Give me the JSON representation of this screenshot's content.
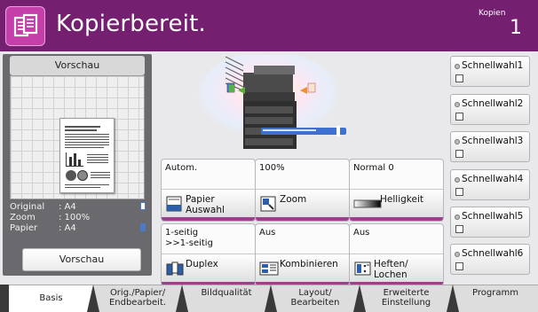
{
  "header": {
    "title": "Kopierbereit.",
    "copies_label": "Kopien",
    "copies_count": "1",
    "icon": "copy-document-icon",
    "colors": {
      "bar": "#741f6f",
      "icon_bg": "#c53fab",
      "accent": "#9b3f91"
    }
  },
  "preview": {
    "title": "Vorschau",
    "info": [
      {
        "label": "Original",
        "value": ": A4",
        "icon": "portrait-page-icon"
      },
      {
        "label": "Zoom",
        "value": ": 100%"
      },
      {
        "label": "Papier",
        "value": ": A4",
        "icon": "paper-tray-icon"
      }
    ],
    "button_label": "Vorschau"
  },
  "functions": {
    "paper": {
      "value": "Autom.",
      "label": "Papier Auswahl",
      "icon": "paper-tray-icon"
    },
    "zoom": {
      "value": "100%",
      "label": "Zoom",
      "icon": "zoom-icon"
    },
    "density": {
      "value": "Normal 0",
      "label": "Helligkeit",
      "icon": "density-icon"
    },
    "duplex": {
      "value_line1": "1-seitig",
      "value_line2": ">>1-seitig",
      "label": "Duplex",
      "icon": "duplex-icon"
    },
    "combine": {
      "value": "Aus",
      "label": "Kombinieren",
      "icon": "combine-icon"
    },
    "staple": {
      "value": "Aus",
      "label": "Heften/ Lochen",
      "icon": "staple-punch-icon"
    }
  },
  "quick": [
    {
      "label": "Schnellwahl1"
    },
    {
      "label": "Schnellwahl2"
    },
    {
      "label": "Schnellwahl3"
    },
    {
      "label": "Schnellwahl4"
    },
    {
      "label": "Schnellwahl5"
    },
    {
      "label": "Schnellwahl6"
    }
  ],
  "tabs": [
    {
      "line1": "Basis",
      "line2": "",
      "active": true
    },
    {
      "line1": "Orig./Papier/",
      "line2": "Endbearbeit.",
      "active": false
    },
    {
      "line1": "Bildqualität",
      "line2": "",
      "active": false
    },
    {
      "line1": "Layout/",
      "line2": "Bearbeiten",
      "active": false
    },
    {
      "line1": "Erweiterte",
      "line2": "Einstellung",
      "active": false
    },
    {
      "line1": "Programm",
      "line2": "",
      "active": false
    }
  ]
}
